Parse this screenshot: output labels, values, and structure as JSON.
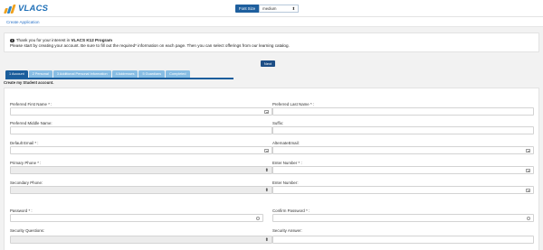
{
  "header": {
    "logo_text": "VLACS",
    "font_size_label": "Font Size",
    "font_size_value": "medium"
  },
  "breadcrumb": "Create Application",
  "notice": {
    "line1_prefix": "Thank you for your interest in",
    "line1_program": "VLACS K12 Program",
    "line2": "Please start by creating your account. Be sure to fill out the required* information on each page. Then you can select offerings from our learning catalog."
  },
  "next_button": "Next",
  "tabs": [
    {
      "label": "1 Account",
      "active": true
    },
    {
      "label": "2 Personal",
      "active": false
    },
    {
      "label": "3 Additional Personal Information",
      "active": false
    },
    {
      "label": "4 Addresses",
      "active": false
    },
    {
      "label": "5 Guardians",
      "active": false
    },
    {
      "label": "Completed",
      "active": false
    }
  ],
  "section_title": "Create my Student account.",
  "fields": {
    "preferred_first_name": "Preferred First Name * :",
    "preferred_last_name": "Preferred Last Name * :",
    "preferred_middle_name": "Preferred Middle Name:",
    "suffix": "Suffix:",
    "default_email": "Default Email * :",
    "alternate_email": "AlternateEmail:",
    "primary_phone": "Primary Phone * :",
    "enter_number_required": "Enter Number * :",
    "secondary_phone": "Secondary Phone:",
    "enter_number": "Enter Number:",
    "password": "Password * :",
    "confirm_password": "Confirm Password * :",
    "security_questions": "Security Questions:",
    "security_answer": "Security Answer:"
  },
  "icons": {
    "dropdown_caret": "⬍"
  },
  "colors": {
    "brand_blue": "#1e6fb7",
    "tab_active": "#1b5e9c",
    "tab_inactive": "#87bde4",
    "next_button": "#1d4e86"
  }
}
